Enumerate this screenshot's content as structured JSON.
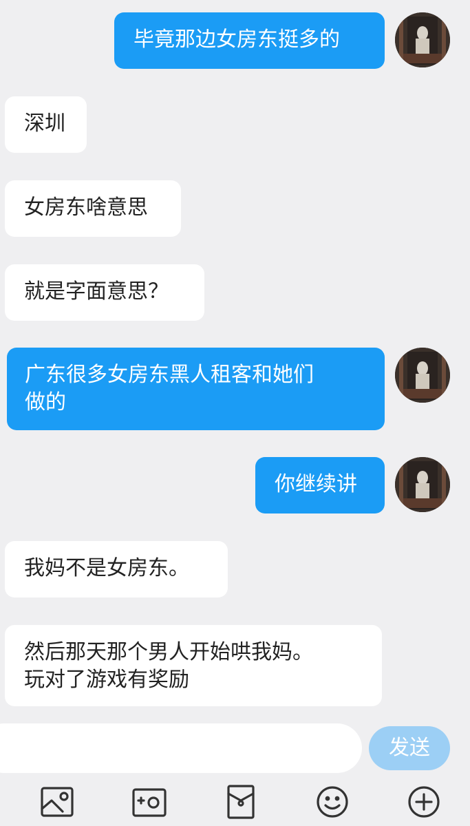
{
  "messages": [
    {
      "side": "out",
      "text": "毕竟那边女房东挺多的"
    },
    {
      "side": "in",
      "text": "深圳"
    },
    {
      "side": "in",
      "text": "女房东啥意思"
    },
    {
      "side": "in",
      "text": "就是字面意思？"
    },
    {
      "side": "out",
      "text": "广东很多女房东黑人租客和她们\n做的"
    },
    {
      "side": "out",
      "text": "你继续讲"
    },
    {
      "side": "in",
      "text": "我妈不是女房东。"
    },
    {
      "side": "in",
      "text": "然后那天那个男人开始哄我妈。\n玩对了游戏有奖励"
    }
  ],
  "composer": {
    "input_value": "",
    "send_label": "发送"
  },
  "toolbar": {
    "icons": [
      "image-icon",
      "camera-icon",
      "red-envelope-icon",
      "emoji-icon",
      "plus-icon"
    ]
  },
  "colors": {
    "outgoing_bubble": "#1b9cf5",
    "incoming_bubble": "#ffffff",
    "background": "#efeff1",
    "send_button": "#9ccff5"
  }
}
